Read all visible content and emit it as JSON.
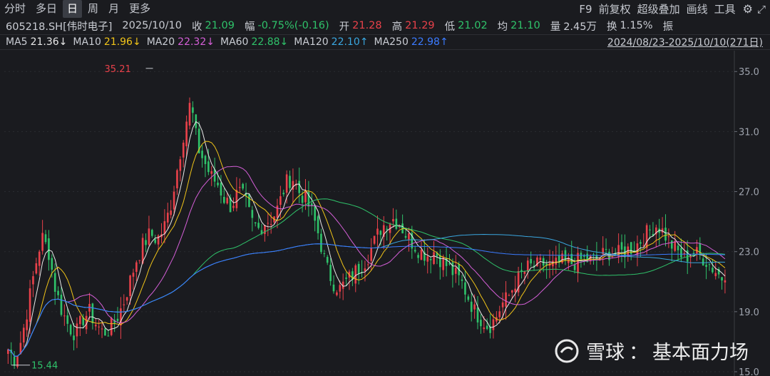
{
  "toolbar": {
    "tabs": [
      {
        "label": "分时",
        "active": false
      },
      {
        "label": "多日",
        "active": false
      },
      {
        "label": "日",
        "active": true
      },
      {
        "label": "周",
        "active": false
      },
      {
        "label": "月",
        "active": false
      },
      {
        "label": "更多",
        "active": false
      }
    ],
    "tools": [
      "F9",
      "前复权",
      "超级叠加",
      "画线",
      "工具"
    ],
    "gear_icon": "gear-icon",
    "expand_icon": "expand-icon"
  },
  "quote": {
    "code_name": "605218.SH[伟时电子]",
    "date": "2025/10/10",
    "close_label": "收",
    "close": "21.09",
    "change_label": "幅",
    "change": "-0.75%(-0.16)",
    "open_label": "开",
    "open": "21.28",
    "high_label": "高",
    "high": "21.29",
    "low_label": "低",
    "low": "21.02",
    "avg_label": "均",
    "avg": "21.10",
    "volume_label": "量",
    "volume": "2.45万",
    "turnover_label": "换",
    "turnover": "1.15%",
    "amplitude_label": "振"
  },
  "ma_bar": {
    "items": [
      {
        "name": "MA5",
        "value": "21.36↓",
        "color": "#e8e8e8"
      },
      {
        "name": "MA10",
        "value": "21.96↓",
        "color": "#f0c419"
      },
      {
        "name": "MA20",
        "value": "22.32↓",
        "color": "#d55fd8"
      },
      {
        "name": "MA60",
        "value": "22.88↓",
        "color": "#2fc26a"
      },
      {
        "name": "MA120",
        "value": "22.10↑",
        "color": "#3aa7e0"
      },
      {
        "name": "MA250",
        "value": "22.98↑",
        "color": "#3b7bff"
      }
    ],
    "range": "2024/08/23-2025/10/10(271日)"
  },
  "chart_data": {
    "type": "candlestick",
    "y_ticks": [
      "35.0",
      "31.0",
      "27.0",
      "23.0",
      "19.0",
      "15.0"
    ],
    "ylim": [
      15,
      36.2
    ],
    "max_label": "35.21",
    "min_label": "15.44",
    "close_series": [
      16.5,
      15.8,
      17.2,
      19.5,
      22.0,
      24.0,
      23.0,
      20.5,
      19.0,
      18.0,
      17.5,
      18.5,
      19.0,
      18.2,
      17.6,
      17.8,
      18.5,
      19.5,
      21.0,
      22.5,
      23.5,
      24.2,
      23.8,
      24.5,
      26.0,
      28.5,
      31.0,
      33.0,
      30.0,
      29.0,
      28.0,
      27.5,
      26.5,
      26.0,
      27.0,
      26.5,
      25.0,
      24.5,
      25.0,
      25.2,
      26.0,
      27.5,
      28.0,
      27.0,
      26.5,
      25.5,
      24.0,
      22.0,
      21.0,
      20.5,
      21.0,
      21.5,
      22.0,
      22.5,
      23.5,
      24.5,
      25.0,
      25.2,
      24.8,
      24.0,
      23.5,
      23.0,
      22.8,
      23.0,
      22.5,
      22.0,
      21.5,
      21.0,
      20.0,
      19.0,
      18.5,
      18.0,
      18.5,
      19.5,
      20.0,
      21.0,
      21.5,
      22.0,
      22.0,
      22.2,
      22.0,
      22.1,
      22.3,
      22.2,
      22.3,
      22.5,
      22.4,
      22.5,
      22.8,
      23.0,
      22.8,
      23.0,
      23.2,
      23.5,
      24.0,
      24.5,
      24.8,
      24.2,
      23.5,
      23.0,
      22.5,
      23.0,
      22.8,
      22.5,
      22.0,
      21.5,
      21.1
    ],
    "ma_series": [
      {
        "name": "MA5",
        "color": "#e8e8e8"
      },
      {
        "name": "MA10",
        "color": "#f0c419"
      },
      {
        "name": "MA20",
        "color": "#d55fd8"
      },
      {
        "name": "MA60",
        "color": "#2fc26a"
      },
      {
        "name": "MA120",
        "color": "#3aa7e0"
      },
      {
        "name": "MA250",
        "color": "#3b7bff"
      }
    ],
    "colors": {
      "up": "#e8414a",
      "down": "#2fc26a",
      "grid": "#2a2c31"
    }
  },
  "watermark": {
    "brand": "雪球",
    "separator": "：",
    "account": "基本面力场"
  }
}
